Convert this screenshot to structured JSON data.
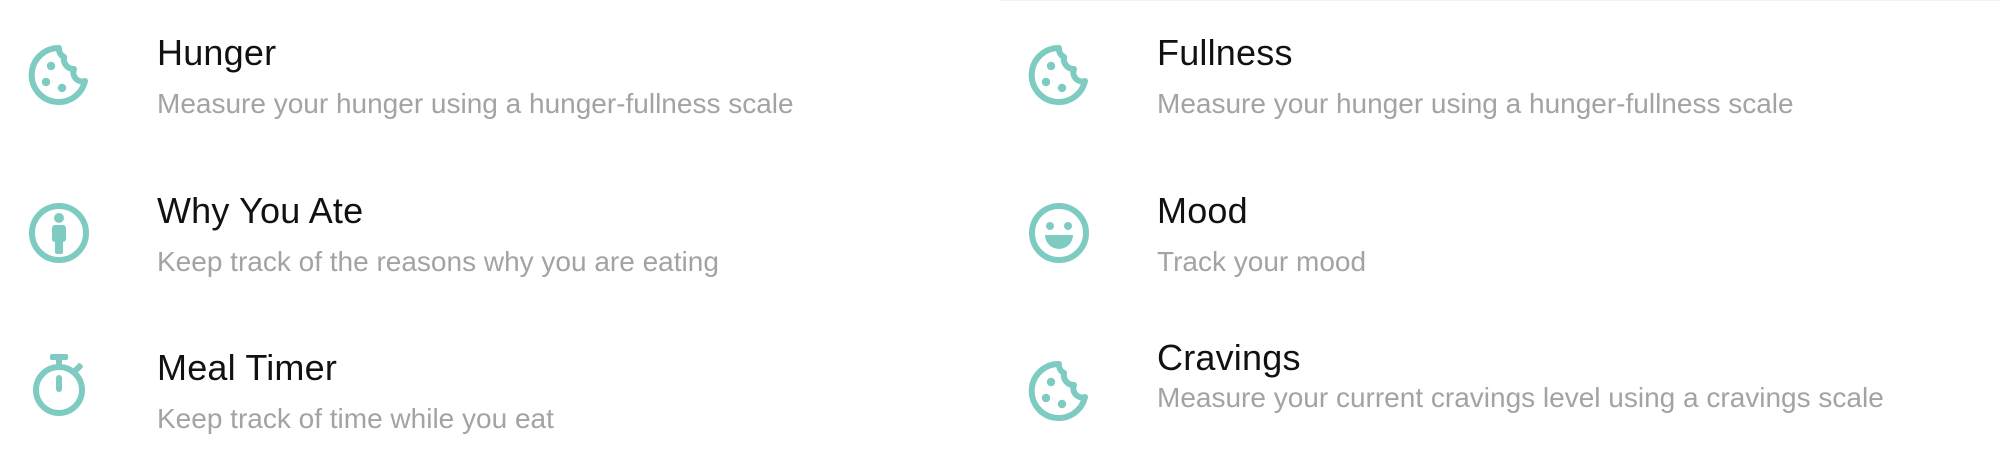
{
  "accent_color": "#7ecbc2",
  "items": [
    {
      "title": "Hunger",
      "description": "Measure your hunger using a hunger-fullness scale",
      "icon": "cookie-icon"
    },
    {
      "title": "Fullness",
      "description": "Measure your hunger using a hunger-fullness scale",
      "icon": "cookie-icon"
    },
    {
      "title": "Why You Ate",
      "description": "Keep track of the reasons why you are eating",
      "icon": "person-circle-icon"
    },
    {
      "title": "Mood",
      "description": "Track your mood",
      "icon": "smiley-icon"
    },
    {
      "title": "Meal Timer",
      "description": "Keep track of time while you eat",
      "icon": "stopwatch-icon"
    },
    {
      "title": "Cravings",
      "description": "Measure your current cravings level using a cravings scale",
      "icon": "cookie-icon"
    }
  ]
}
